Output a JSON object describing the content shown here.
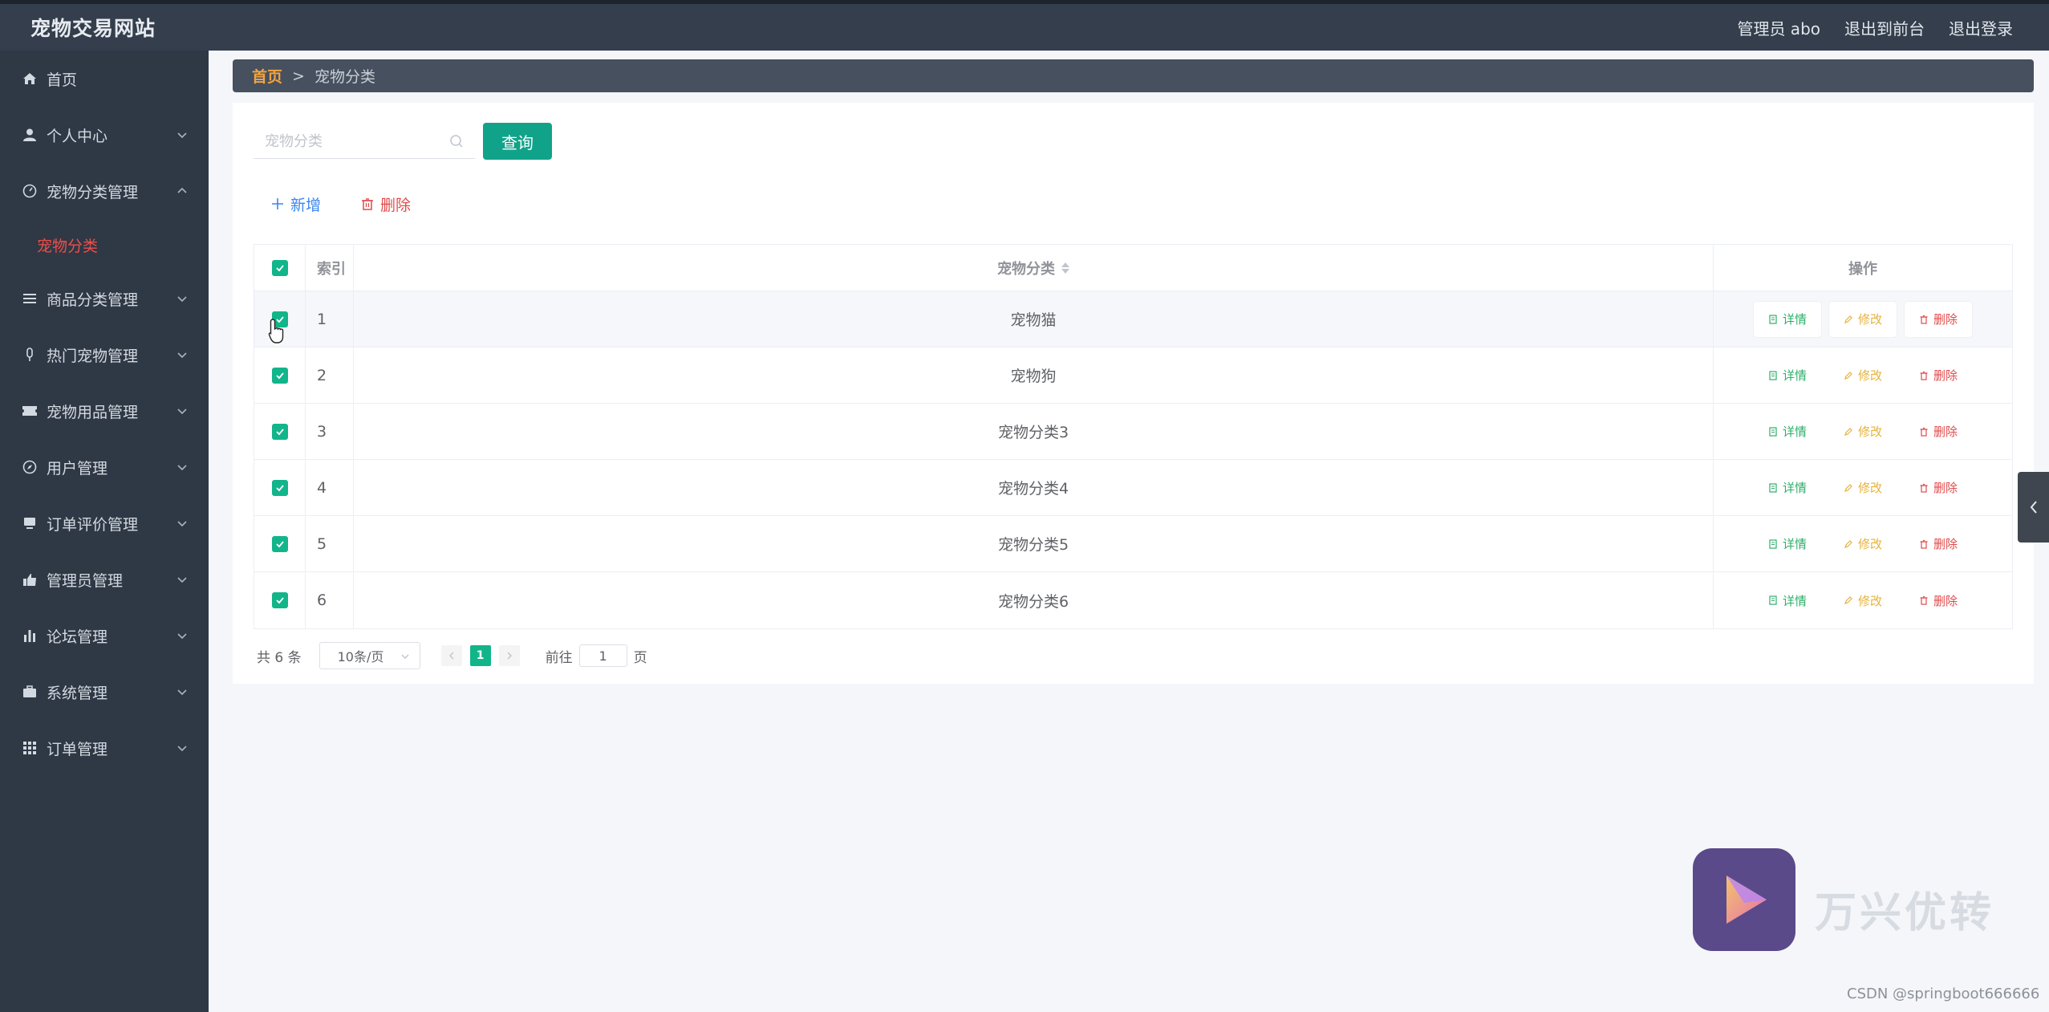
{
  "app": {
    "title": "宠物交易网站",
    "header_links": [
      "管理员 abo",
      "退出到前台",
      "退出登录"
    ]
  },
  "sidebar": {
    "items": [
      {
        "label": "首页",
        "icon": "home-icon",
        "expandable": false
      },
      {
        "label": "个人中心",
        "icon": "user-icon",
        "expandable": true
      },
      {
        "label": "宠物分类管理",
        "icon": "gauge-icon",
        "expandable": true,
        "expanded": true,
        "children": [
          "宠物分类"
        ]
      },
      {
        "label": "商品分类管理",
        "icon": "list-icon",
        "expandable": true
      },
      {
        "label": "热门宠物管理",
        "icon": "mic-icon",
        "expandable": true
      },
      {
        "label": "宠物用品管理",
        "icon": "ticket-icon",
        "expandable": true
      },
      {
        "label": "用户管理",
        "icon": "compass-icon",
        "expandable": true
      },
      {
        "label": "订单评价管理",
        "icon": "monitor-icon",
        "expandable": true
      },
      {
        "label": "管理员管理",
        "icon": "thumb-icon",
        "expandable": true
      },
      {
        "label": "论坛管理",
        "icon": "bar-chart-icon",
        "expandable": true
      },
      {
        "label": "系统管理",
        "icon": "briefcase-icon",
        "expandable": true
      },
      {
        "label": "订单管理",
        "icon": "grid-icon",
        "expandable": true
      }
    ],
    "active_child": "宠物分类"
  },
  "breadcrumb": {
    "home": "首页",
    "separator": ">",
    "current": "宠物分类"
  },
  "search": {
    "placeholder": "宠物分类",
    "button": "查询"
  },
  "actions": {
    "add": "新增",
    "delete": "删除"
  },
  "table": {
    "headers": {
      "index": "索引",
      "name": "宠物分类",
      "ops": "操作"
    },
    "ops_labels": {
      "detail": "详情",
      "edit": "修改",
      "delete": "删除"
    },
    "rows": [
      {
        "index": "1",
        "name": "宠物猫"
      },
      {
        "index": "2",
        "name": "宠物狗"
      },
      {
        "index": "3",
        "name": "宠物分类3"
      },
      {
        "index": "4",
        "name": "宠物分类4"
      },
      {
        "index": "5",
        "name": "宠物分类5"
      },
      {
        "index": "6",
        "name": "宠物分类6"
      }
    ]
  },
  "pagination": {
    "total": "共 6 条",
    "page_size": "10条/页",
    "current": "1",
    "goto_label": "前往",
    "goto_value": "1",
    "page_suffix": "页"
  },
  "watermark": {
    "text": "万兴优转",
    "credit": "CSDN @springboot666666"
  },
  "colors": {
    "topbar": "#343e4c",
    "sidebar": "#2f3845",
    "accent": "#12b589",
    "active": "#ee4e4a"
  }
}
